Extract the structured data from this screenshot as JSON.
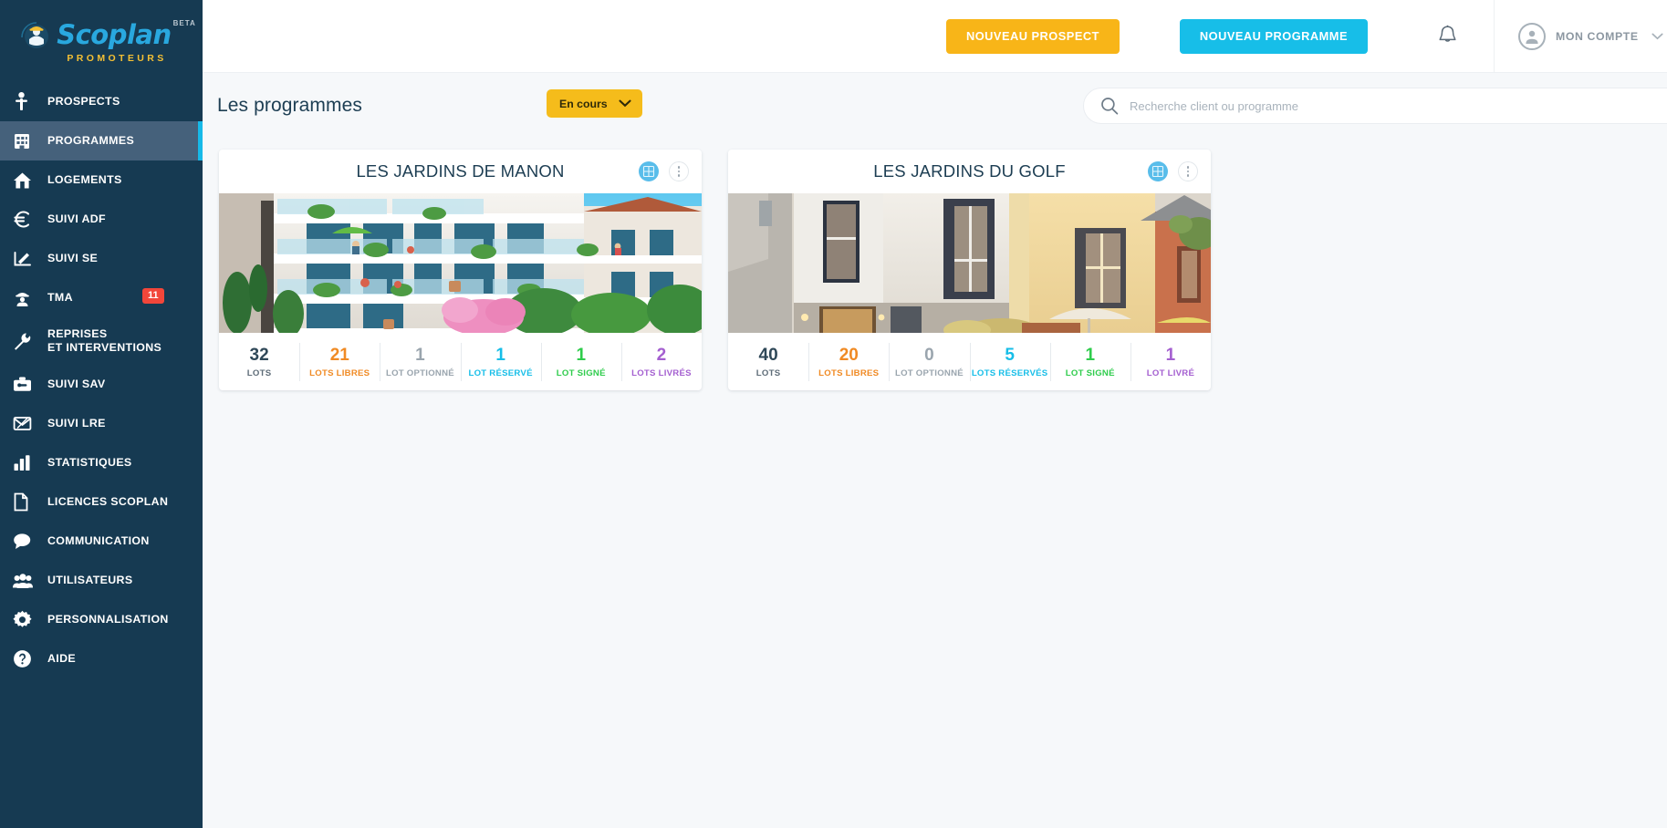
{
  "brand": {
    "name": "Scoplan",
    "beta": "BETA",
    "tagline": "PROMOTEURS"
  },
  "sidebar": {
    "items": [
      {
        "label": "PROSPECTS",
        "icon": "person-icon",
        "active": false,
        "badge": null
      },
      {
        "label": "PROGRAMMES",
        "icon": "building-icon",
        "active": true,
        "badge": null
      },
      {
        "label": "LOGEMENTS",
        "icon": "home-icon",
        "active": false,
        "badge": null
      },
      {
        "label": "SUIVI ADF",
        "icon": "euro-icon",
        "active": false,
        "badge": null
      },
      {
        "label": "SUIVI SE",
        "icon": "signature-icon",
        "active": false,
        "badge": null
      },
      {
        "label": "TMA",
        "icon": "worker-icon",
        "active": false,
        "badge": "11"
      },
      {
        "label": "REPRISES\nET INTERVENTIONS",
        "icon": "wrench-icon",
        "active": false,
        "badge": null
      },
      {
        "label": "SUIVI SAV",
        "icon": "toolbox-icon",
        "active": false,
        "badge": null
      },
      {
        "label": "SUIVI LRE",
        "icon": "mail-icon",
        "active": false,
        "badge": null
      },
      {
        "label": "STATISTIQUES",
        "icon": "bar-chart-icon",
        "active": false,
        "badge": null
      },
      {
        "label": "LICENCES SCOPLAN",
        "icon": "document-icon",
        "active": false,
        "badge": null
      },
      {
        "label": "COMMUNICATION",
        "icon": "chat-icon",
        "active": false,
        "badge": null
      },
      {
        "label": "UTILISATEURS",
        "icon": "users-icon",
        "active": false,
        "badge": null
      },
      {
        "label": "PERSONNALISATION",
        "icon": "gear-icon",
        "active": false,
        "badge": null
      },
      {
        "label": "AIDE",
        "icon": "help-icon",
        "active": false,
        "badge": null
      }
    ]
  },
  "topbar": {
    "new_prospect_label": "NOUVEAU PROSPECT",
    "new_programme_label": "NOUVEAU PROGRAMME",
    "account_label": "MON COMPTE"
  },
  "page": {
    "title": "Les programmes",
    "filter_value": "En cours",
    "search_placeholder": "Recherche client ou programme",
    "search_value": ""
  },
  "colors": {
    "sidebar_bg": "#163A52",
    "sidebar_active_bg": "#45617B",
    "accent_cyan": "#17BEE8",
    "accent_yellow": "#F8B518",
    "badge_red": "#F2463A",
    "lots": "#2F4858",
    "lots_libres": "#F08A24",
    "lot_optionne": "#9AA5AE",
    "lot_reserve": "#17BEE8",
    "lot_signe": "#2FCC4C",
    "lots_livres": "#A45FD0"
  },
  "programmes": [
    {
      "name": "LES JARDINS DE MANON",
      "image": "apartment-building-render",
      "stats": [
        {
          "value": "32",
          "label": "LOTS",
          "color": "#2F4858"
        },
        {
          "value": "21",
          "label": "LOTS LIBRES",
          "color": "#F08A24"
        },
        {
          "value": "1",
          "label": "LOT OPTIONNÉ",
          "color": "#9AA5AE"
        },
        {
          "value": "1",
          "label": "LOT RÉSERVÉ",
          "color": "#17BEE8"
        },
        {
          "value": "1",
          "label": "LOT SIGNÉ",
          "color": "#2FCC4C"
        },
        {
          "value": "2",
          "label": "LOTS LIVRÉS",
          "color": "#A45FD0"
        }
      ]
    },
    {
      "name": "LES JARDINS DU GOLF",
      "image": "townhouse-render",
      "stats": [
        {
          "value": "40",
          "label": "LOTS",
          "color": "#2F4858"
        },
        {
          "value": "20",
          "label": "LOTS LIBRES",
          "color": "#F08A24"
        },
        {
          "value": "0",
          "label": "LOT OPTIONNÉ",
          "color": "#9AA5AE"
        },
        {
          "value": "5",
          "label": "LOTS RÉSERVÉS",
          "color": "#17BEE8"
        },
        {
          "value": "1",
          "label": "LOT SIGNÉ",
          "color": "#2FCC4C"
        },
        {
          "value": "1",
          "label": "LOT LIVRÉ",
          "color": "#A45FD0"
        }
      ]
    }
  ]
}
